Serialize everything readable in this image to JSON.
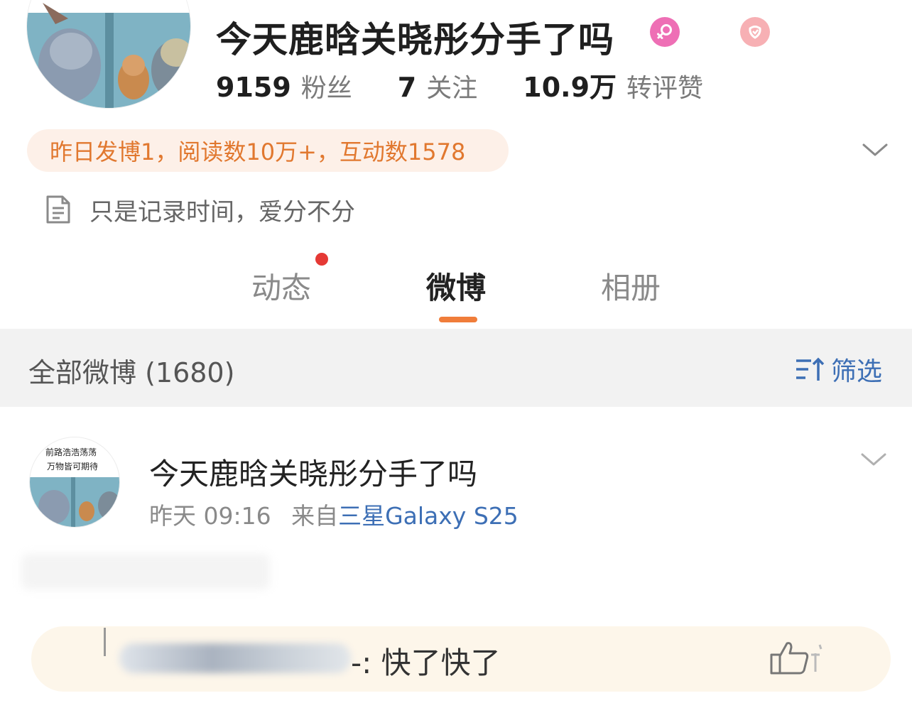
{
  "profile": {
    "name": "今天鹿晗关晓彤分手了吗",
    "stats": [
      {
        "value": "9159",
        "label": "粉丝"
      },
      {
        "value": "7",
        "label": "关注"
      },
      {
        "value": "10.9万",
        "label": "转评赞"
      }
    ],
    "activity_summary": "昨日发博1，阅读数10万+，互动数1578",
    "bio": "只是记录时间，爱分不分"
  },
  "tabs": [
    {
      "label": "动态",
      "has_dot": true
    },
    {
      "label": "微博",
      "active": true
    },
    {
      "label": "相册"
    }
  ],
  "filter_bar": {
    "count_label": "全部微博 (1680)",
    "filter_label": "筛选"
  },
  "post": {
    "author": "今天鹿晗关晓彤分手了吗",
    "avatar_text_line1": "前路浩浩荡荡",
    "avatar_text_line2": "万物皆可期待",
    "time": "昨天 09:16",
    "source_prefix": "来自",
    "device": "三星Galaxy S25"
  },
  "comment": {
    "separator": "-:",
    "text": "快了快了"
  },
  "colors": {
    "accent_orange": "#f07d3a",
    "link_blue": "#3d6fb5",
    "badge_pink": "#ee6fb5",
    "activity_text": "#e1782f"
  },
  "icons": [
    "female-icon",
    "vip-badge-icon",
    "chevron-down-icon",
    "document-icon",
    "filter-icon",
    "thumbs-up-icon"
  ]
}
